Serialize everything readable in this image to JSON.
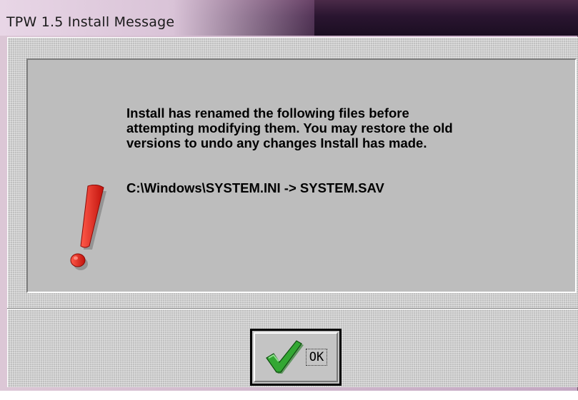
{
  "window": {
    "title": "TPW 1.5 Install Message"
  },
  "message": {
    "lines": [
      "Install has renamed the following files before",
      "attempting modifying them. You may restore the old",
      "versions to undo any changes Install has made."
    ],
    "file_rename": "C:\\Windows\\SYSTEM.INI -> SYSTEM.SAV"
  },
  "icons": {
    "warning": "exclamation-icon",
    "ok": "checkmark-icon"
  },
  "buttons": {
    "ok_label": "OK"
  },
  "colors": {
    "warning_red": "#e2231a",
    "check_green": "#2f9e2f",
    "dialog_gray": "#c0c0c0"
  }
}
